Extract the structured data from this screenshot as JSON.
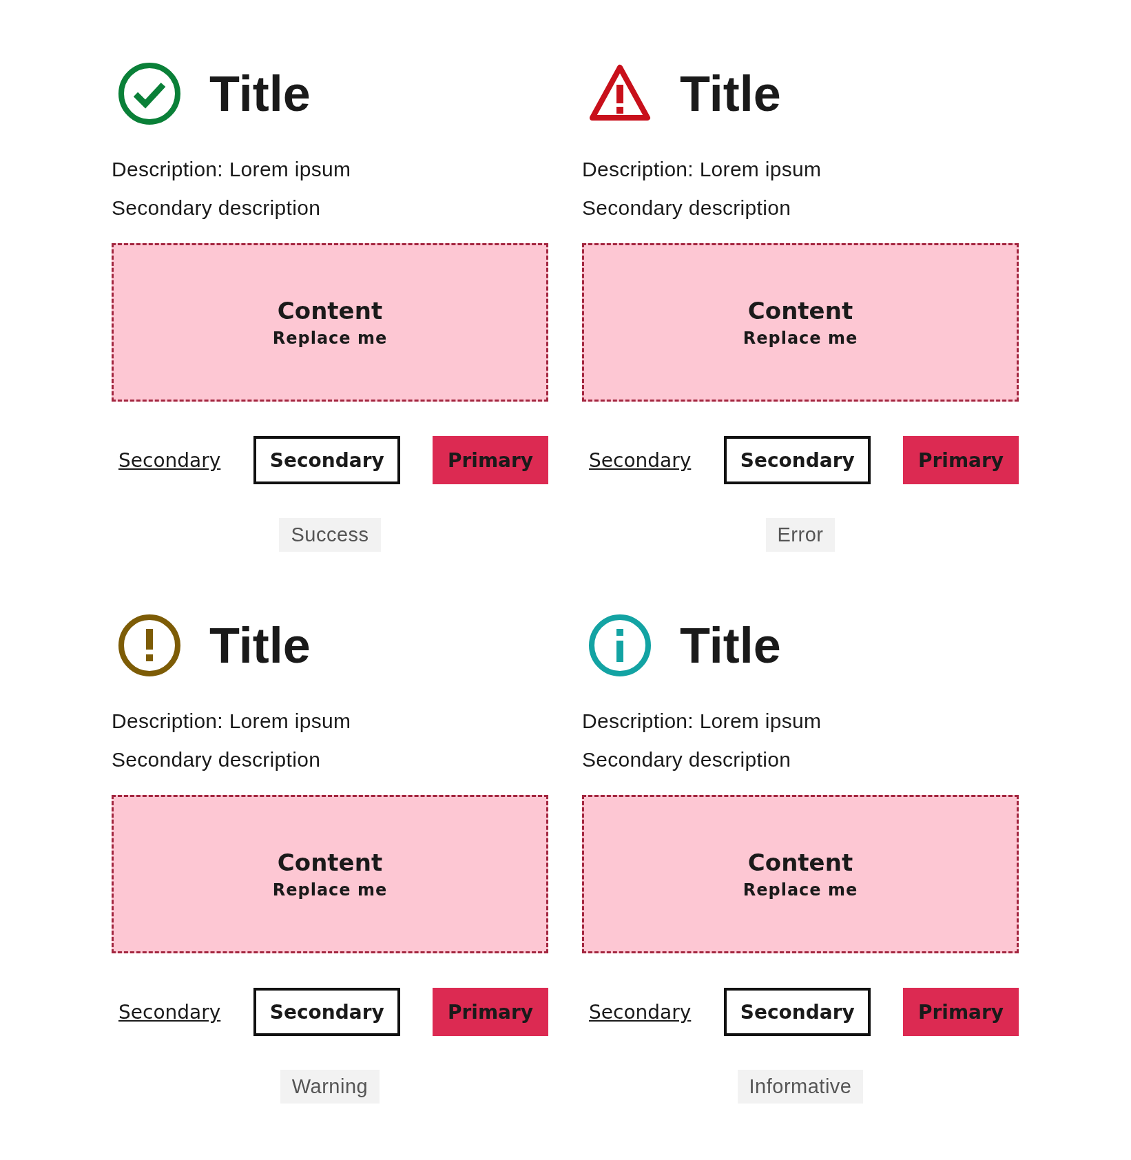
{
  "panels": [
    {
      "kind": "success",
      "title": "Title",
      "description": "Description: Lorem ipsum",
      "secondary_description": "Secondary description",
      "content": {
        "heading": "Content",
        "subheading": "Replace me"
      },
      "buttons": [
        {
          "kind": "link",
          "label": "Secondary"
        },
        {
          "kind": "outline",
          "label": "Secondary"
        },
        {
          "kind": "primary",
          "label": "Primary"
        }
      ],
      "tag": "Success"
    },
    {
      "kind": "error",
      "title": "Title",
      "description": "Description: Lorem ipsum",
      "secondary_description": "Secondary description",
      "content": {
        "heading": "Content",
        "subheading": "Replace me"
      },
      "buttons": [
        {
          "kind": "link",
          "label": "Secondary"
        },
        {
          "kind": "outline",
          "label": "Secondary"
        },
        {
          "kind": "primary",
          "label": "Primary"
        }
      ],
      "tag": "Error"
    },
    {
      "kind": "warning",
      "title": "Title",
      "description": "Description: Lorem ipsum",
      "secondary_description": "Secondary description",
      "content": {
        "heading": "Content",
        "subheading": "Replace me"
      },
      "buttons": [
        {
          "kind": "link",
          "label": "Secondary"
        },
        {
          "kind": "outline",
          "label": "Secondary"
        },
        {
          "kind": "primary",
          "label": "Primary"
        }
      ],
      "tag": "Warning"
    },
    {
      "kind": "informative",
      "title": "Title",
      "description": "Description: Lorem ipsum",
      "secondary_description": "Secondary description",
      "content": {
        "heading": "Content",
        "subheading": "Replace me"
      },
      "buttons": [
        {
          "kind": "link",
          "label": "Secondary"
        },
        {
          "kind": "outline",
          "label": "Secondary"
        },
        {
          "kind": "primary",
          "label": "Primary"
        }
      ],
      "tag": "Informative"
    }
  ]
}
